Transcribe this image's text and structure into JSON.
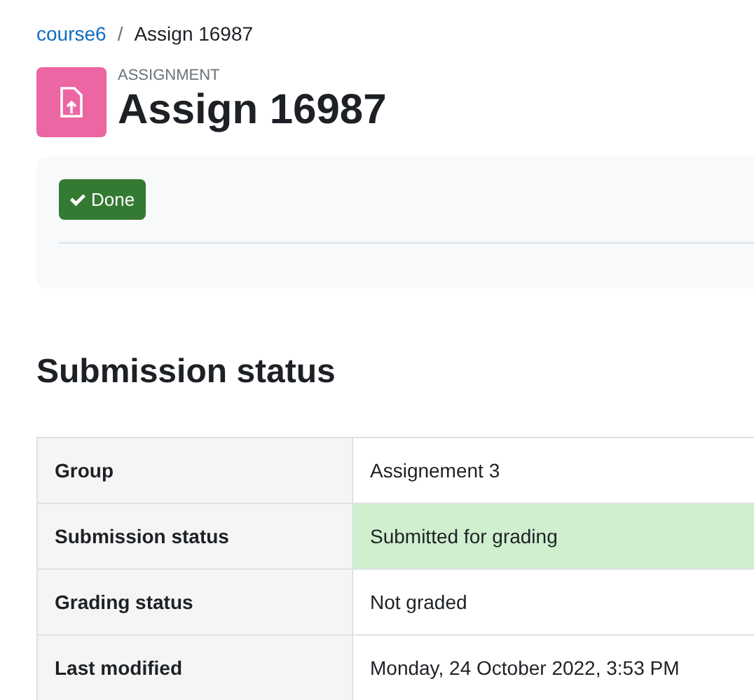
{
  "breadcrumb": [
    {
      "label": "course6",
      "link": true
    },
    {
      "label": "Assign 16987",
      "link": false
    }
  ],
  "breadcrumb_separator": "/",
  "header": {
    "kind_label": "ASSIGNMENT",
    "title": "Assign 16987"
  },
  "completion": {
    "label": "Done",
    "done": true
  },
  "section_title": "Submission status",
  "rows": [
    {
      "label": "Group",
      "value": "Assignement 3",
      "highlighted": false
    },
    {
      "label": "Submission status",
      "value": "Submitted for grading",
      "highlighted": true
    },
    {
      "label": "Grading status",
      "value": "Not graded",
      "highlighted": false
    },
    {
      "label": "Last modified",
      "value": "Monday, 24 October 2022, 3:53 PM",
      "highlighted": false
    }
  ]
}
